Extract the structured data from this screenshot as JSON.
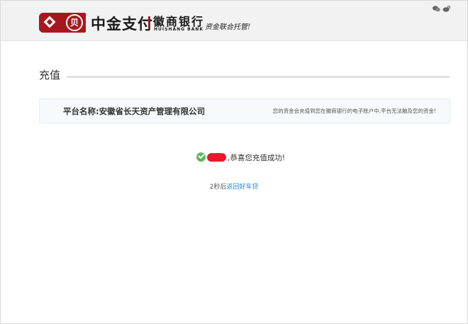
{
  "header": {
    "logo_seal": "贝",
    "brand_name": "中金支付",
    "bank_name_cn": "徽商银行",
    "bank_name_en": "HUISHANG BANK",
    "slogan": "资金联合托管!",
    "icons": [
      "wechat-icon",
      "weibo-icon"
    ]
  },
  "page": {
    "title": "充值"
  },
  "platform": {
    "label": "平台名称:安徽省长天资产管理有限公司",
    "note": "您的资金会充值到您在徽商银行的电子账户中,平台无法触及您的资金!"
  },
  "result": {
    "success_text": ",恭喜您充值成功!",
    "redirect_prefix": "2秒后",
    "redirect_link": "返回好车贷"
  },
  "colors": {
    "brand_red": "#a8171e",
    "success_green": "#5cb85c",
    "link_blue": "#1e88d8"
  }
}
